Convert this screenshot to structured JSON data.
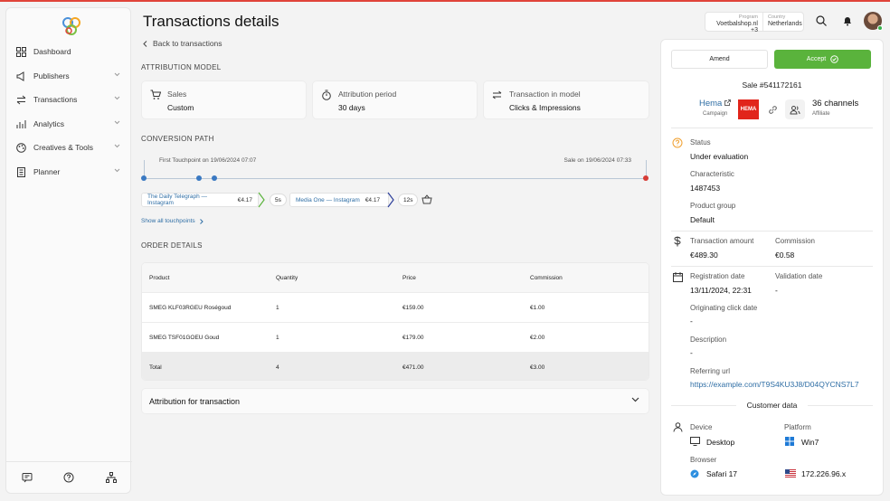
{
  "header": {
    "title": "Transactions details",
    "back_label": "Back to transactions",
    "program_label": "Program",
    "program_value": "Voetbalshop.nl +3",
    "country_label": "Country",
    "country_value": "Netherlands"
  },
  "sidebar": {
    "items": [
      {
        "label": "Dashboard",
        "icon": "dashboard-icon"
      },
      {
        "label": "Publishers",
        "icon": "megaphone-icon"
      },
      {
        "label": "Transactions",
        "icon": "arrows-icon"
      },
      {
        "label": "Analytics",
        "icon": "analytics-icon"
      },
      {
        "label": "Creatives & Tools",
        "icon": "palette-icon"
      },
      {
        "label": "Planner",
        "icon": "planner-icon"
      }
    ]
  },
  "attribution": {
    "section": "ATTRIBUTION MODEL",
    "cards": [
      {
        "title": "Sales",
        "value": "Custom"
      },
      {
        "title": "Attribution period",
        "value": "30 days"
      },
      {
        "title": "Transaction in model",
        "value": "Clicks & Impressions"
      }
    ]
  },
  "conversion": {
    "section": "CONVERSION PATH",
    "first_touch": "First Touchpoint on 19/06/2024 07:07",
    "sale": "Sale on 19/06/2024 07:33",
    "touchpoints": [
      {
        "name": "The Daily Telegraph — Instagram",
        "price": "€4.17"
      },
      {
        "name": "Media One — Instagram",
        "price": "€4.17"
      }
    ],
    "times": [
      "5s",
      "12s"
    ],
    "show_all": "Show all touchpoints"
  },
  "order": {
    "section": "ORDER DETAILS",
    "columns": [
      "Product",
      "Quantity",
      "Price",
      "Commission"
    ],
    "rows": [
      [
        "SMEG KLF03RGEU Roségoud",
        "1",
        "€159.00",
        "€1.00"
      ],
      [
        "SMEG TSF01GOEU Goud",
        "1",
        "€179.00",
        "€2.00"
      ]
    ],
    "total": [
      "Total",
      "4",
      "€471.00",
      "€3.00"
    ]
  },
  "attribution_accordion": "Attribution for transaction",
  "panel": {
    "amend": "Amend",
    "accept": "Accept",
    "sale_id": "Sale #541172161",
    "campaign_name": "Hema",
    "campaign_label": "Campaign",
    "logo_text": "HEMA",
    "affiliate_name": "36 channels",
    "affiliate_label": "Affiliate",
    "status_label": "Status",
    "status_value": "Under evaluation",
    "characteristic_label": "Characteristic",
    "characteristic_value": "1487453",
    "product_group_label": "Product group",
    "product_group_value": "Default",
    "amount_label": "Transaction amount",
    "amount_value": "€489.30",
    "commission_label": "Commission",
    "commission_value": "€0.58",
    "reg_label": "Registration date",
    "reg_value": "13/11/2024, 22:31",
    "validation_label": "Validation date",
    "validation_value": "-",
    "orig_label": "Originating click date",
    "orig_value": "-",
    "desc_label": "Description",
    "desc_value": "-",
    "ref_label": "Referring url",
    "ref_value": "https://example.com/T9S4KU3J8/D04QYCNS7L7",
    "customer_title": "Customer data",
    "device_label": "Device",
    "device_value": "Desktop",
    "platform_label": "Platform",
    "platform_value": "Win7",
    "browser_label": "Browser",
    "browser_value": "Safari 17",
    "ip_value": "172.226.96.x"
  },
  "colors": {
    "accent_green": "#5ab33c",
    "link_blue": "#2f6ea5",
    "red": "#d63b35"
  }
}
